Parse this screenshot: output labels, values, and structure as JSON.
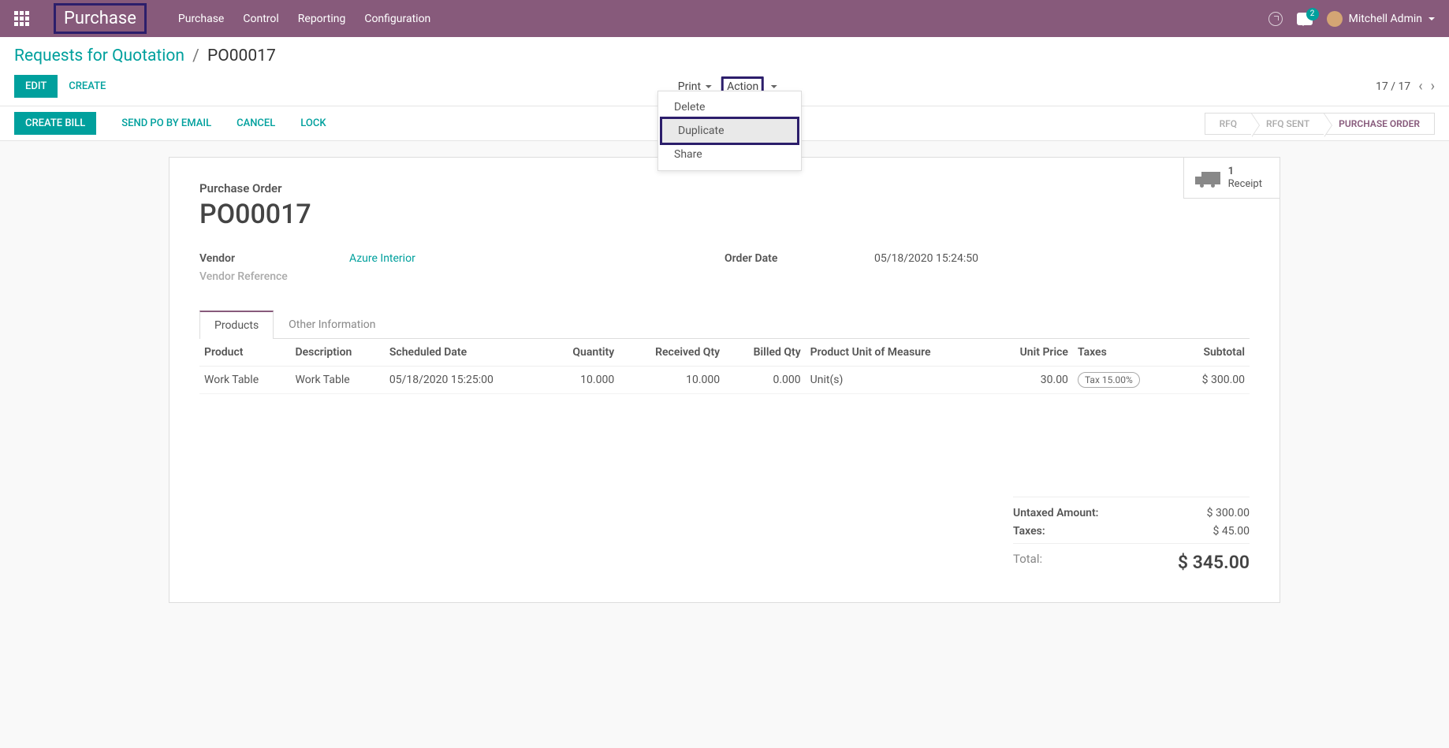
{
  "nav": {
    "app_title": "Purchase",
    "menu": [
      "Purchase",
      "Control",
      "Reporting",
      "Configuration"
    ],
    "chat_count": "2",
    "user_name": "Mitchell Admin"
  },
  "breadcrumb": {
    "root": "Requests for Quotation",
    "current": "PO00017"
  },
  "controls": {
    "edit": "EDIT",
    "create": "CREATE",
    "print": "Print",
    "action": "Action",
    "pager": "17 / 17"
  },
  "action_menu": {
    "delete": "Delete",
    "duplicate": "Duplicate",
    "share": "Share"
  },
  "status_bar": {
    "create_bill": "CREATE BILL",
    "send_po": "SEND PO BY EMAIL",
    "cancel": "CANCEL",
    "lock": "LOCK",
    "steps": {
      "rfq": "RFQ",
      "rfq_sent": "RFQ SENT",
      "po": "PURCHASE ORDER"
    }
  },
  "stat_button": {
    "count": "1",
    "label": "Receipt"
  },
  "sheet": {
    "label": "Purchase Order",
    "number": "PO00017",
    "vendor_label": "Vendor",
    "vendor": "Azure Interior",
    "vendor_ref_label": "Vendor Reference",
    "order_date_label": "Order Date",
    "order_date": "05/18/2020 15:24:50"
  },
  "tabs": {
    "products": "Products",
    "other": "Other Information"
  },
  "table": {
    "headers": {
      "product": "Product",
      "desc": "Description",
      "sched": "Scheduled Date",
      "qty": "Quantity",
      "recv": "Received Qty",
      "billed": "Billed Qty",
      "uom": "Product Unit of Measure",
      "price": "Unit Price",
      "taxes": "Taxes",
      "subtotal": "Subtotal"
    },
    "row": {
      "product": "Work Table",
      "desc": "Work Table",
      "sched": "05/18/2020 15:25:00",
      "qty": "10.000",
      "recv": "10.000",
      "billed": "0.000",
      "uom": "Unit(s)",
      "price": "30.00",
      "tax": "Tax 15.00%",
      "subtotal": "$ 300.00"
    }
  },
  "totals": {
    "untaxed_label": "Untaxed Amount:",
    "untaxed": "$ 300.00",
    "taxes_label": "Taxes:",
    "taxes": "$ 45.00",
    "total_label": "Total:",
    "total": "$ 345.00"
  }
}
